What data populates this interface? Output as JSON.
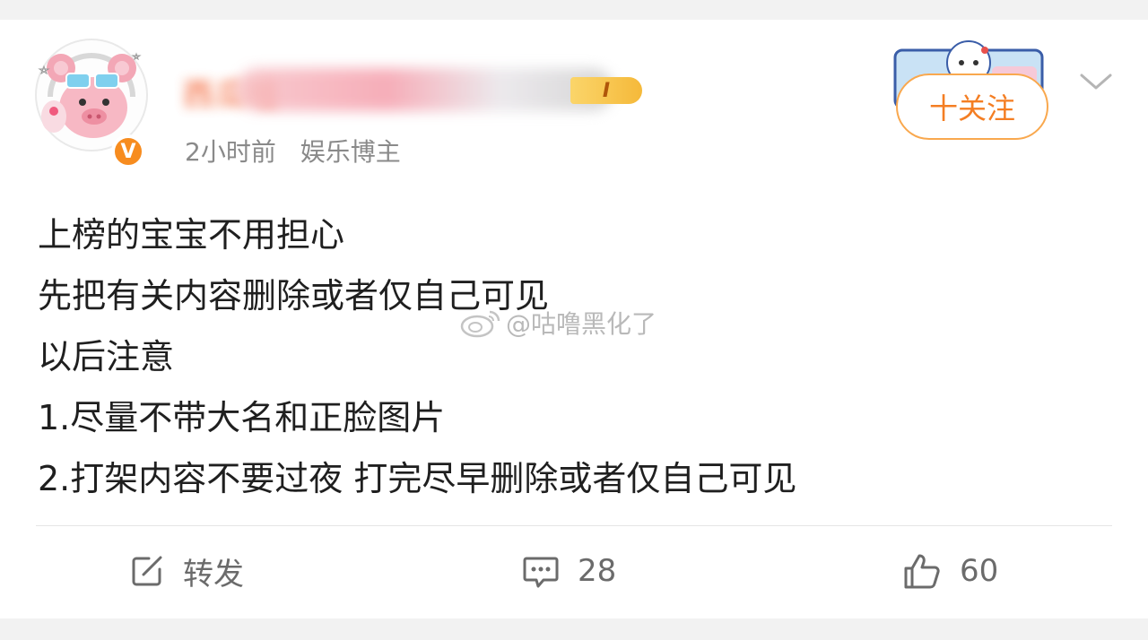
{
  "post": {
    "username": "西瓜喵",
    "level_badge": "I",
    "time": "2小时前",
    "role": "娱乐博主",
    "follow_label": "十关注",
    "lines": [
      "上榜的宝宝不用担心",
      "先把有关内容删除或者仅自己可见",
      "以后注意",
      "1.尽量不带大名和正脸图片",
      "2.打架内容不要过夜 打完尽早删除或者仅自己可见"
    ],
    "watermark": "@咕噜黑化了"
  },
  "actions": {
    "repost_label": "转发",
    "comments_count": "28",
    "likes_count": "60"
  },
  "colors": {
    "accent": "#f47e23",
    "verified": "#f78c1f",
    "name": "#f35b2a"
  },
  "icons": [
    "avatar-pig",
    "verified-v-icon",
    "chevron-down-icon",
    "repost-icon",
    "comment-icon",
    "like-icon",
    "weibo-logo-icon"
  ]
}
